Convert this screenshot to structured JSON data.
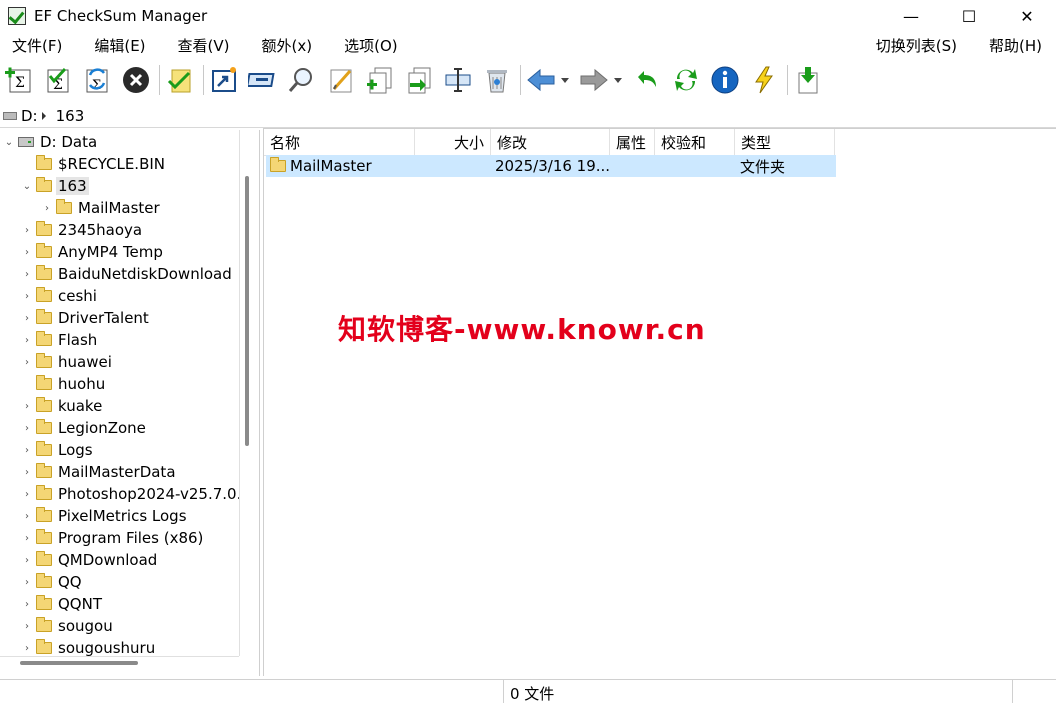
{
  "window": {
    "title": "EF CheckSum Manager",
    "controls": {
      "minimize": "—",
      "maximize": "☐",
      "close": "✕"
    }
  },
  "menu": {
    "left": [
      "文件(F)",
      "编辑(E)",
      "查看(V)",
      "额外(x)",
      "选项(O)"
    ],
    "right": [
      "切换列表(S)",
      "帮助(H)"
    ]
  },
  "toolbar": {
    "icons": [
      "new-checksum-icon",
      "verify-checksum-icon",
      "refresh-checksum-icon",
      "stop-icon",
      "check-folder-icon",
      "open-shortcut-icon",
      "drive-icon",
      "find-icon",
      "edit-icon",
      "copy-add-icon",
      "move-icon",
      "properties-icon",
      "delete-icon",
      "back-icon",
      "forward-icon",
      "undo-icon",
      "refresh-icon",
      "info-icon",
      "lightning-icon",
      "download-icon"
    ]
  },
  "address": {
    "segments": [
      "D:",
      "163"
    ]
  },
  "tree": {
    "root": "D: Data",
    "items": [
      {
        "label": "$RECYCLE.BIN",
        "expander": ""
      },
      {
        "label": "163",
        "expander": "⌄",
        "selected": true
      },
      {
        "label": "MailMaster",
        "expander": "›",
        "child": true
      },
      {
        "label": "2345haoya",
        "expander": "›"
      },
      {
        "label": "AnyMP4 Temp",
        "expander": "›"
      },
      {
        "label": "BaiduNetdiskDownload",
        "expander": "›"
      },
      {
        "label": "ceshi",
        "expander": "›"
      },
      {
        "label": "DriverTalent",
        "expander": "›"
      },
      {
        "label": "Flash",
        "expander": "›"
      },
      {
        "label": "huawei",
        "expander": "›"
      },
      {
        "label": "huohu",
        "expander": ""
      },
      {
        "label": "kuake",
        "expander": "›"
      },
      {
        "label": "LegionZone",
        "expander": "›"
      },
      {
        "label": "Logs",
        "expander": "›"
      },
      {
        "label": "MailMasterData",
        "expander": "›"
      },
      {
        "label": "Photoshop2024-v25.7.0.",
        "expander": "›"
      },
      {
        "label": "PixelMetrics Logs",
        "expander": "›"
      },
      {
        "label": "Program Files (x86)",
        "expander": "›"
      },
      {
        "label": "QMDownload",
        "expander": "›"
      },
      {
        "label": "QQ",
        "expander": "›"
      },
      {
        "label": "QQNT",
        "expander": "›"
      },
      {
        "label": "sougou",
        "expander": "›"
      },
      {
        "label": "sougoushuru",
        "expander": "›"
      }
    ]
  },
  "list": {
    "columns": [
      "名称",
      "大小",
      "修改",
      "属性",
      "校验和",
      "类型"
    ],
    "rows": [
      {
        "name": "MailMaster",
        "size": "",
        "modified": "2025/3/16  19...",
        "attributes": "",
        "checksum": "",
        "type": "文件夹"
      }
    ]
  },
  "watermark": "知软博客-www.knowr.cn",
  "status": {
    "text": "0 文件"
  }
}
